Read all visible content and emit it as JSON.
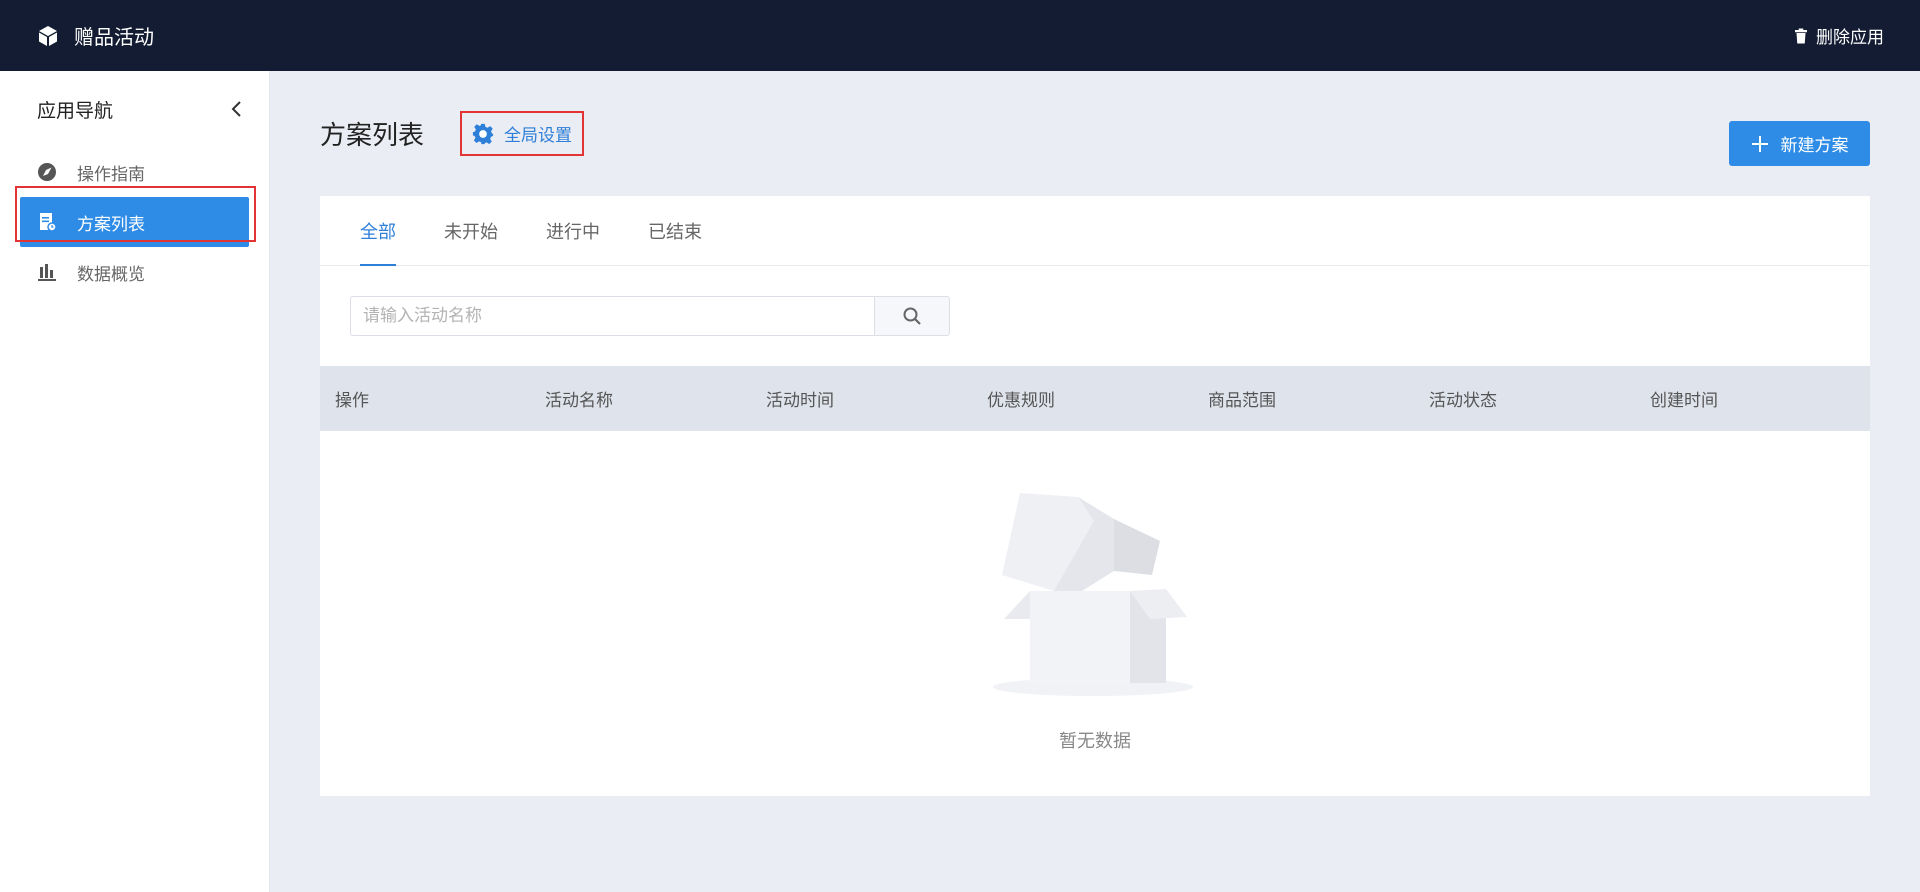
{
  "app": {
    "title": "赠品活动",
    "delete_label": "删除应用"
  },
  "sidebar": {
    "heading": "应用导航",
    "items": [
      {
        "label": "操作指南",
        "icon": "compass-icon"
      },
      {
        "label": "方案列表",
        "icon": "document-icon"
      },
      {
        "label": "数据概览",
        "icon": "bar-chart-icon"
      }
    ],
    "active_index": 1
  },
  "page": {
    "title": "方案列表",
    "global_settings_label": "全局设置",
    "new_button_label": "新建方案"
  },
  "tabs": [
    "全部",
    "未开始",
    "进行中",
    "已结束"
  ],
  "search": {
    "placeholder": "请输入活动名称",
    "value": ""
  },
  "table": {
    "columns": [
      "操作",
      "活动名称",
      "活动时间",
      "优惠规则",
      "商品范围",
      "活动状态",
      "创建时间"
    ],
    "empty_text": "暂无数据"
  },
  "colors": {
    "topbar": "#131c33",
    "accent": "#2e8ce6",
    "highlight": "#e23434",
    "header_row": "#dfe3eb"
  }
}
